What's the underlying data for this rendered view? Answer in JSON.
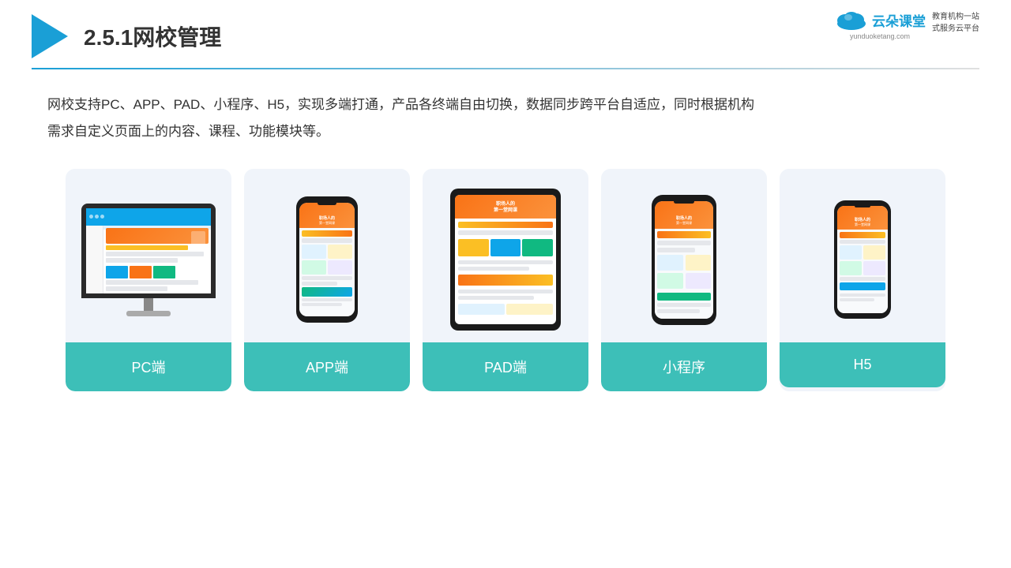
{
  "header": {
    "title": "2.5.1网校管理",
    "line_color": "#1a9fd6"
  },
  "brand": {
    "name": "云朵课堂",
    "url": "yunduoketang.com",
    "tagline": "教育机构一站\n式服务云平台"
  },
  "description": "网校支持PC、APP、PAD、小程序、H5，实现多端打通，产品各终端自由切换，数据同步跨平台自适应，同时根据机构\n需求自定义页面上的内容、课程、功能模块等。",
  "cards": [
    {
      "id": "pc",
      "label": "PC端"
    },
    {
      "id": "app",
      "label": "APP端"
    },
    {
      "id": "pad",
      "label": "PAD端"
    },
    {
      "id": "miniapp",
      "label": "小程序"
    },
    {
      "id": "h5",
      "label": "H5"
    }
  ],
  "accent_color": "#3dbfb8"
}
